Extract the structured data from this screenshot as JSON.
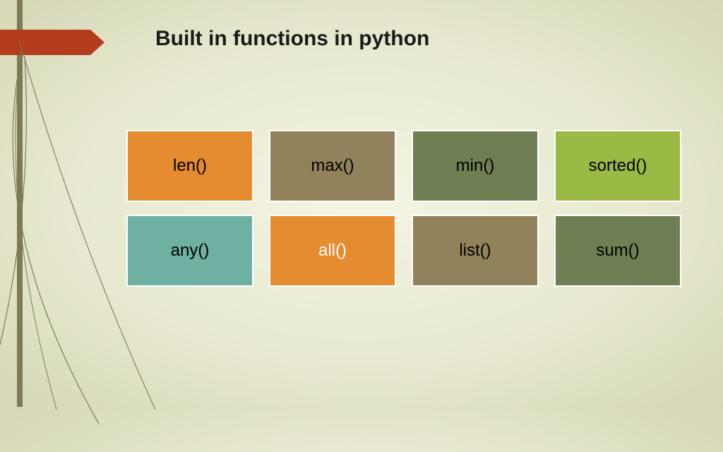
{
  "title": "Built in functions in python",
  "tiles": [
    {
      "label": "len()",
      "style": "c-orange"
    },
    {
      "label": "max()",
      "style": "c-olive"
    },
    {
      "label": "min()",
      "style": "c-moss"
    },
    {
      "label": "sorted()",
      "style": "c-lime"
    },
    {
      "label": "any()",
      "style": "c-teal"
    },
    {
      "label": "all()",
      "style": "c-orange-w"
    },
    {
      "label": "list()",
      "style": "c-olive"
    },
    {
      "label": "sum()",
      "style": "c-moss"
    }
  ],
  "colors": {
    "accent": "#b33c1c",
    "bar": "#7d7a5a"
  }
}
